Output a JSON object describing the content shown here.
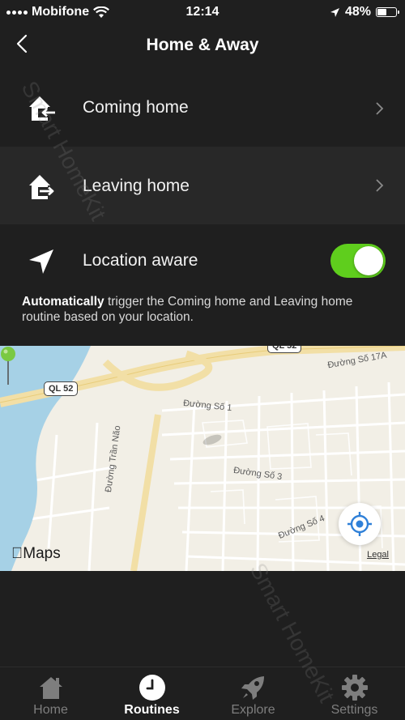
{
  "status_bar": {
    "carrier": "Mobifone",
    "time": "12:14",
    "battery_percent": "48%",
    "battery_level": 0.48
  },
  "nav": {
    "title": "Home & Away"
  },
  "rows": {
    "coming_home": "Coming home",
    "leaving_home": "Leaving home",
    "location_aware": "Location aware",
    "location_aware_enabled": true
  },
  "description": {
    "bold": "Automatically",
    "rest": " trigger the Coming home and Leaving home routine based on your location."
  },
  "map": {
    "shield_ql52": "QL 52",
    "shield_top": "QL 52",
    "street_so_1": "Đường Số 1",
    "street_so_3": "Đường Số 3",
    "street_so_4": "Đường Số 4",
    "street_so_17a": "Đường Số 17A",
    "street_tran_nao": "Đường Trần Não",
    "brand": "Maps",
    "legal": "Legal"
  },
  "tabs": [
    {
      "label": "Home",
      "icon": "house-icon",
      "active": false
    },
    {
      "label": "Routines",
      "icon": "clock-icon",
      "active": true
    },
    {
      "label": "Explore",
      "icon": "rocket-icon",
      "active": false
    },
    {
      "label": "Settings",
      "icon": "gear-icon",
      "active": false
    }
  ],
  "watermark": "Smart HomeKit",
  "colors": {
    "background": "#1f1f1f",
    "toggle_on": "#5fce1d",
    "pin": "#7ac943",
    "locate": "#2f80d8",
    "river": "#a6d1e6"
  }
}
